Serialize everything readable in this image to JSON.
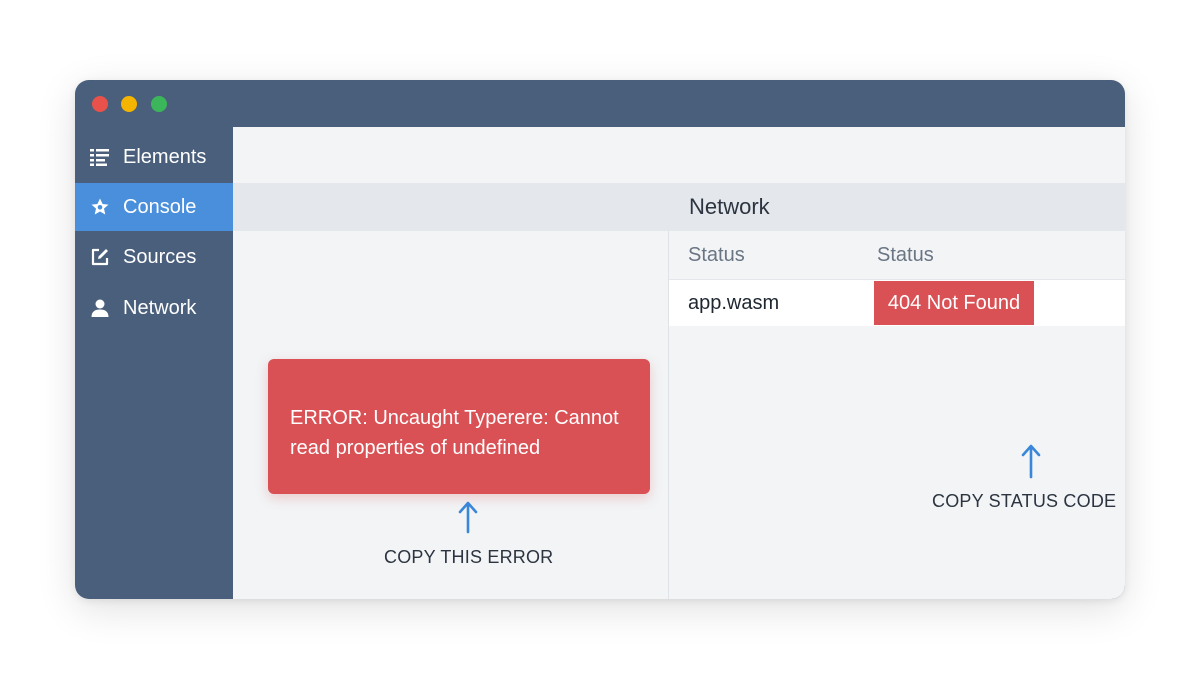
{
  "sidebar": {
    "items": [
      {
        "label": "Elements",
        "icon": "list-icon",
        "active": false
      },
      {
        "label": "Console",
        "icon": "star-icon",
        "active": true
      },
      {
        "label": "Sources",
        "icon": "edit-icon",
        "active": false
      },
      {
        "label": "Network",
        "icon": "user-icon",
        "active": false
      }
    ]
  },
  "network": {
    "title": "Network",
    "columns": [
      "Status",
      "Status"
    ],
    "rows": [
      {
        "file": "app.wasm",
        "status": "404 Not Found"
      }
    ]
  },
  "console": {
    "error_text": "ERROR: Uncaught Typerere: Cannot read properties of undefined"
  },
  "annotations": {
    "copy_error": "COPY THIS ERROR",
    "copy_status": "COPY STATUS CODE"
  },
  "colors": {
    "window_frame": "#4a5f7b",
    "active_item": "#4a8fdb",
    "error_red": "#d95155",
    "arrow_blue": "#3a86d8"
  }
}
